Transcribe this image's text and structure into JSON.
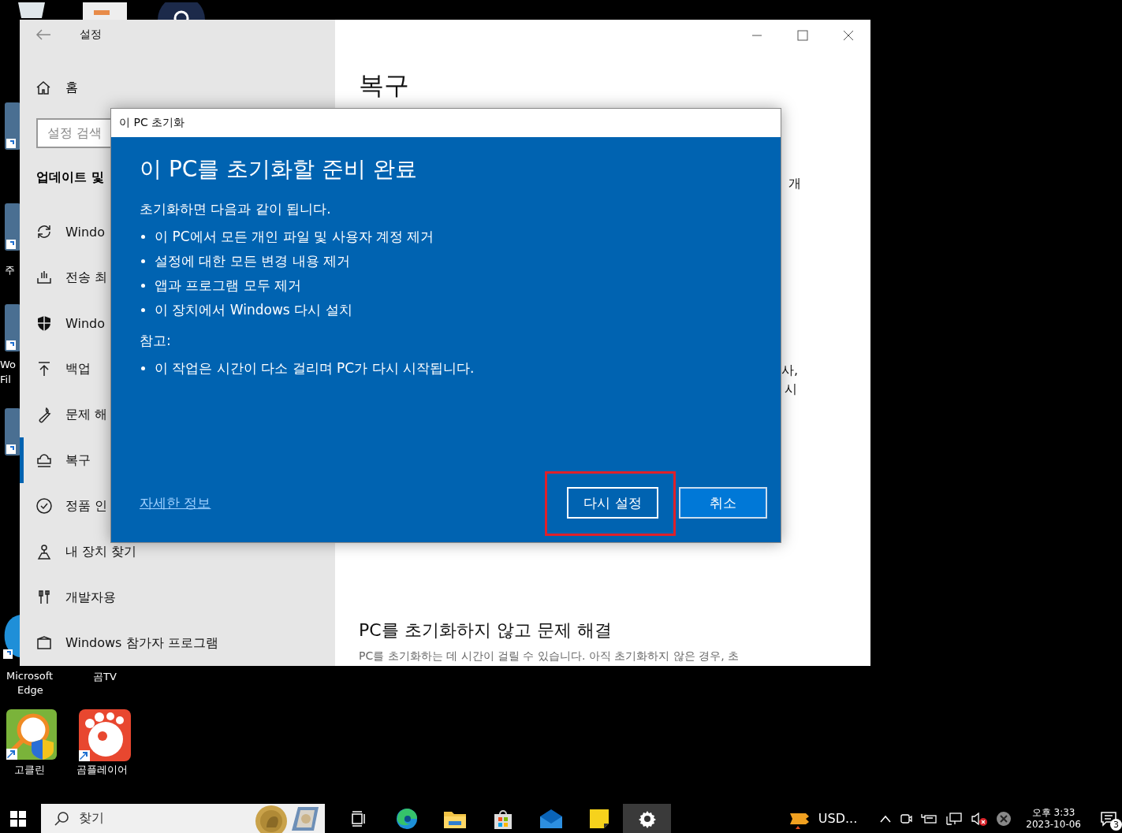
{
  "desktop": {
    "icons": [
      {
        "label": "주",
        "kind": "tile"
      },
      {
        "label": "Wo",
        "kind": "tile"
      },
      {
        "label": "Fil",
        "kind": "none"
      },
      {
        "label": "Microsoft",
        "kind": "edge"
      },
      {
        "label": "Edge",
        "kind": "none"
      },
      {
        "label": "곰TV",
        "kind": "none"
      },
      {
        "label": "고클린",
        "kind": "goclean"
      },
      {
        "label": "곰플레이어",
        "kind": "gomplayer"
      }
    ]
  },
  "settings": {
    "title": "설정",
    "home": "홈",
    "search": {
      "placeholder": "설정 검색"
    },
    "section": "업데이트 및",
    "nav": [
      {
        "label": "Windo",
        "selected": false
      },
      {
        "label": "전송 최",
        "selected": false
      },
      {
        "label": "Windo",
        "selected": false
      },
      {
        "label": "백업",
        "selected": false
      },
      {
        "label": "문제 해",
        "selected": false
      },
      {
        "label": "복구",
        "selected": true
      },
      {
        "label": "정품 인",
        "selected": false
      },
      {
        "label": "내 장치 찾기",
        "selected": false
      },
      {
        "label": "개발자용",
        "selected": false
      },
      {
        "label": "Windows 참가자 프로그램",
        "selected": false
      }
    ],
    "page_title": "복구",
    "fragments": [
      "개",
      "사,",
      "시"
    ],
    "section_title": "PC를 초기화하지 않고 문제 해결",
    "section_text": "PC를 초기화하는 데 시간이 걸릴 수 있습니다. 아직 초기화하지 않은 경우, 초"
  },
  "dialog": {
    "title": "이 PC 초기화",
    "heading": "이 PC를 초기화할 준비 완료",
    "intro": "초기화하면 다음과 같이 됩니다.",
    "bullets": [
      "이 PC에서 모든 개인 파일 및 사용자 계정 제거",
      "설정에 대한 모든 변경 내용 제거",
      "앱과 프로그램 모두 제거",
      "이 장치에서 Windows 다시 설치"
    ],
    "note_label": "참고:",
    "note_bullets": [
      "이 작업은 시간이 다소 걸리며 PC가 다시 시작됩니다."
    ],
    "link": "자세한 정보",
    "buttons": [
      {
        "label": "다시 설정",
        "primary": false,
        "highlighted": true
      },
      {
        "label": "취소",
        "primary": true,
        "highlighted": false
      }
    ]
  },
  "taskbar": {
    "search": {
      "placeholder": "찾기"
    },
    "apps": [
      {
        "kind": "taskview",
        "active": false
      },
      {
        "kind": "edge",
        "active": false
      },
      {
        "kind": "folder",
        "active": false
      },
      {
        "kind": "store",
        "active": false
      },
      {
        "kind": "mail",
        "active": false
      },
      {
        "kind": "notes",
        "active": false
      },
      {
        "kind": "settings",
        "active": true
      }
    ],
    "tray_app": "USD...",
    "time": "오후 3:33",
    "date": "2023-10-06",
    "notifications": "3"
  }
}
